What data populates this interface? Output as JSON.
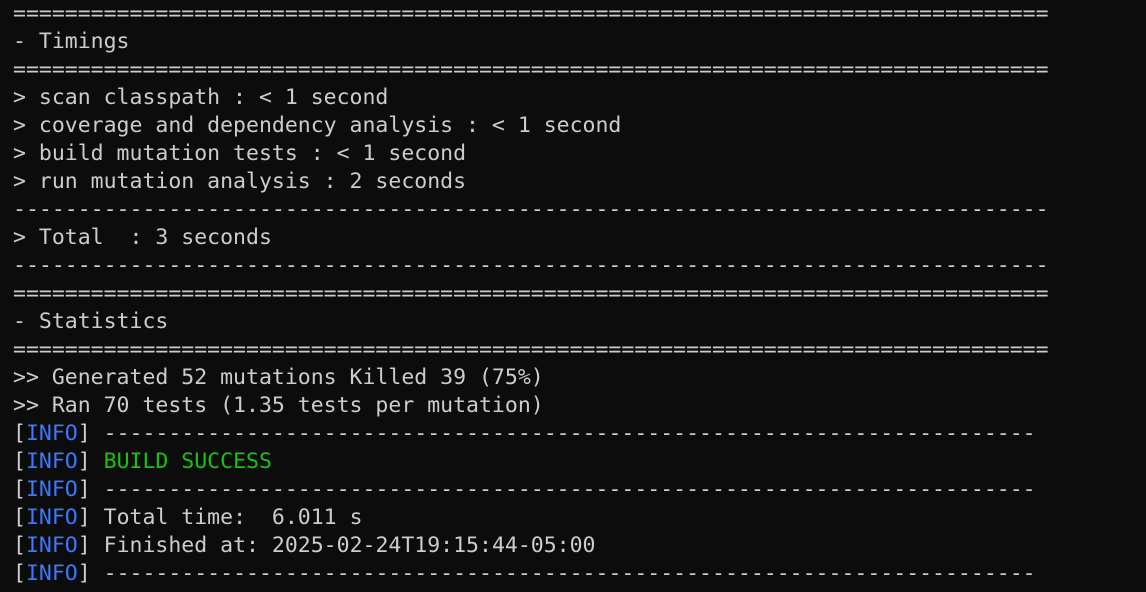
{
  "terminal": {
    "lines": [
      {
        "kind": "rule",
        "text": "================================================================================"
      },
      {
        "kind": "text",
        "text": "- Timings"
      },
      {
        "kind": "rule",
        "text": "================================================================================"
      },
      {
        "kind": "text",
        "text": "> scan classpath : < 1 second"
      },
      {
        "kind": "text",
        "text": "> coverage and dependency analysis : < 1 second"
      },
      {
        "kind": "text",
        "text": "> build mutation tests : < 1 second"
      },
      {
        "kind": "text",
        "text": "> run mutation analysis : 2 seconds"
      },
      {
        "kind": "rule",
        "text": "--------------------------------------------------------------------------------"
      },
      {
        "kind": "text",
        "text": "> Total  : 3 seconds"
      },
      {
        "kind": "rule",
        "text": "--------------------------------------------------------------------------------"
      },
      {
        "kind": "rule",
        "text": "================================================================================"
      },
      {
        "kind": "text",
        "text": "- Statistics"
      },
      {
        "kind": "rule",
        "text": "================================================================================"
      },
      {
        "kind": "text",
        "text": ">> Generated 52 mutations Killed 39 (75%)"
      },
      {
        "kind": "text",
        "text": ">> Ran 70 tests (1.35 tests per mutation)"
      },
      {
        "kind": "info",
        "tag": "INFO",
        "text": "------------------------------------------------------------------------"
      },
      {
        "kind": "info",
        "tag": "INFO",
        "text": "BUILD SUCCESS",
        "status": "success"
      },
      {
        "kind": "info",
        "tag": "INFO",
        "text": "------------------------------------------------------------------------"
      },
      {
        "kind": "info",
        "tag": "INFO",
        "text": "Total time:  6.011 s"
      },
      {
        "kind": "info",
        "tag": "INFO",
        "text": "Finished at: 2025-02-24T19:15:44-05:00"
      },
      {
        "kind": "info",
        "tag": "INFO",
        "text": "------------------------------------------------------------------------"
      }
    ]
  },
  "colors": {
    "background": "#0c0c0c",
    "foreground": "#cccccc",
    "info_tag": "#3b78ff",
    "success": "#16c60c"
  }
}
